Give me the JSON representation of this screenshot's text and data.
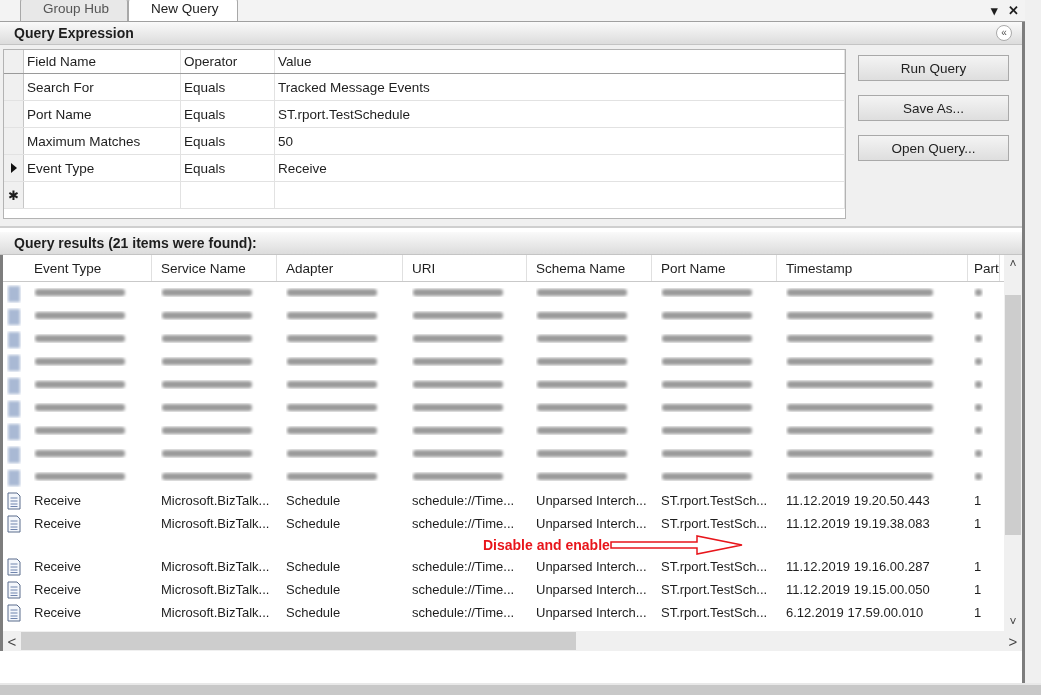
{
  "tabs": [
    {
      "label": "Group Hub",
      "selected": false
    },
    {
      "label": "New Query",
      "selected": true
    }
  ],
  "window_controls": [
    "▾",
    "✕"
  ],
  "query_expression": {
    "title": "Query Expression",
    "collapse_icon": "«",
    "columns": [
      "Field Name",
      "Operator",
      "Value"
    ],
    "rows": [
      {
        "field": "Search For",
        "operator": "Equals",
        "value": "Tracked Message Events",
        "current": false
      },
      {
        "field": "Port Name",
        "operator": "Equals",
        "value": "ST.rport.TestSchedule",
        "current": false
      },
      {
        "field": "Maximum Matches",
        "operator": "Equals",
        "value": "50",
        "current": false
      },
      {
        "field": "Event Type",
        "operator": "Equals",
        "value": "Receive",
        "current": true
      }
    ],
    "new_row_marker": "✱",
    "buttons": [
      "Run Query",
      "Save As...",
      "Open Query..."
    ]
  },
  "results": {
    "title": "Query results (21 items were found):",
    "columns": [
      "Event Type",
      "Service Name",
      "Adapter",
      "URI",
      "Schema Name",
      "Port Name",
      "Timestamp",
      "Part"
    ],
    "rows": [
      {
        "kind": "blurred"
      },
      {
        "kind": "blurred"
      },
      {
        "kind": "blurred"
      },
      {
        "kind": "blurred"
      },
      {
        "kind": "blurred"
      },
      {
        "kind": "blurred"
      },
      {
        "kind": "blurred"
      },
      {
        "kind": "blurred"
      },
      {
        "kind": "blurred"
      },
      {
        "kind": "message",
        "cells": [
          "Receive",
          "Microsoft.BizTalk...",
          "Schedule",
          "schedule://Time...",
          "Unparsed Interch...",
          "ST.rport.TestSch...",
          "11.12.2019 19.20.50.443",
          "1"
        ]
      },
      {
        "kind": "message",
        "cells": [
          "Receive",
          "Microsoft.BizTalk...",
          "Schedule",
          "schedule://Time...",
          "Unparsed Interch...",
          "ST.rport.TestSch...",
          "11.12.2019 19.19.38.083",
          "1"
        ]
      },
      {
        "kind": "annotation",
        "text": "Disable and enable"
      },
      {
        "kind": "message",
        "cells": [
          "Receive",
          "Microsoft.BizTalk...",
          "Schedule",
          "schedule://Time...",
          "Unparsed Interch...",
          "ST.rport.TestSch...",
          "11.12.2019 19.16.00.287",
          "1"
        ]
      },
      {
        "kind": "message",
        "cells": [
          "Receive",
          "Microsoft.BizTalk...",
          "Schedule",
          "schedule://Time...",
          "Unparsed Interch...",
          "ST.rport.TestSch...",
          "11.12.2019 19.15.00.050",
          "1"
        ]
      },
      {
        "kind": "message",
        "cells": [
          "Receive",
          "Microsoft.BizTalk...",
          "Schedule",
          "schedule://Time...",
          "Unparsed Interch...",
          "ST.rport.TestSch...",
          "6.12.2019 17.59.00.010",
          "1"
        ]
      }
    ]
  },
  "scroll_arrows": {
    "up": "˄",
    "down": "˅",
    "left": "<",
    "right": ">"
  }
}
